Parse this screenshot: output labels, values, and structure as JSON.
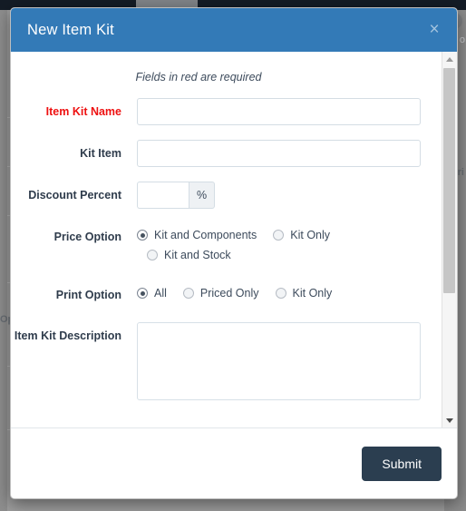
{
  "background": {
    "nav_fragment_char": "o",
    "table_text_fragment": "Op",
    "right_text_fragment": "ri"
  },
  "modal": {
    "title": "New Item Kit",
    "close_label": "×",
    "required_note": "Fields in red are required",
    "fields": {
      "item_kit_name": {
        "label": "Item Kit Name",
        "value": "",
        "placeholder": "",
        "required": true
      },
      "kit_item": {
        "label": "Kit Item",
        "value": "",
        "placeholder": "",
        "required": false
      },
      "discount_percent": {
        "label": "Discount Percent",
        "value": "",
        "placeholder": "",
        "addon": "%",
        "required": false
      },
      "price_option": {
        "label": "Price Option",
        "selected": "Kit and Components",
        "options": [
          {
            "label": "Kit and Components",
            "checked": true
          },
          {
            "label": "Kit Only",
            "checked": false
          },
          {
            "label": "Kit and Stock",
            "checked": false
          }
        ]
      },
      "print_option": {
        "label": "Print Option",
        "selected": "All",
        "options": [
          {
            "label": "All",
            "checked": true
          },
          {
            "label": "Priced Only",
            "checked": false
          },
          {
            "label": "Kit Only",
            "checked": false
          }
        ]
      },
      "item_kit_description": {
        "label": "Item Kit Description",
        "value": "",
        "placeholder": ""
      }
    },
    "footer": {
      "submit_label": "Submit"
    },
    "scrollbar": {
      "up_icon": "chevron-up-icon",
      "down_icon": "chevron-down-icon"
    }
  },
  "colors": {
    "header_blue": "#337ab7",
    "submit_navy": "#2b3e50",
    "required_red": "#ee1111",
    "label_text": "#2f3c4c",
    "page_backdrop": "#b9b9b9"
  }
}
